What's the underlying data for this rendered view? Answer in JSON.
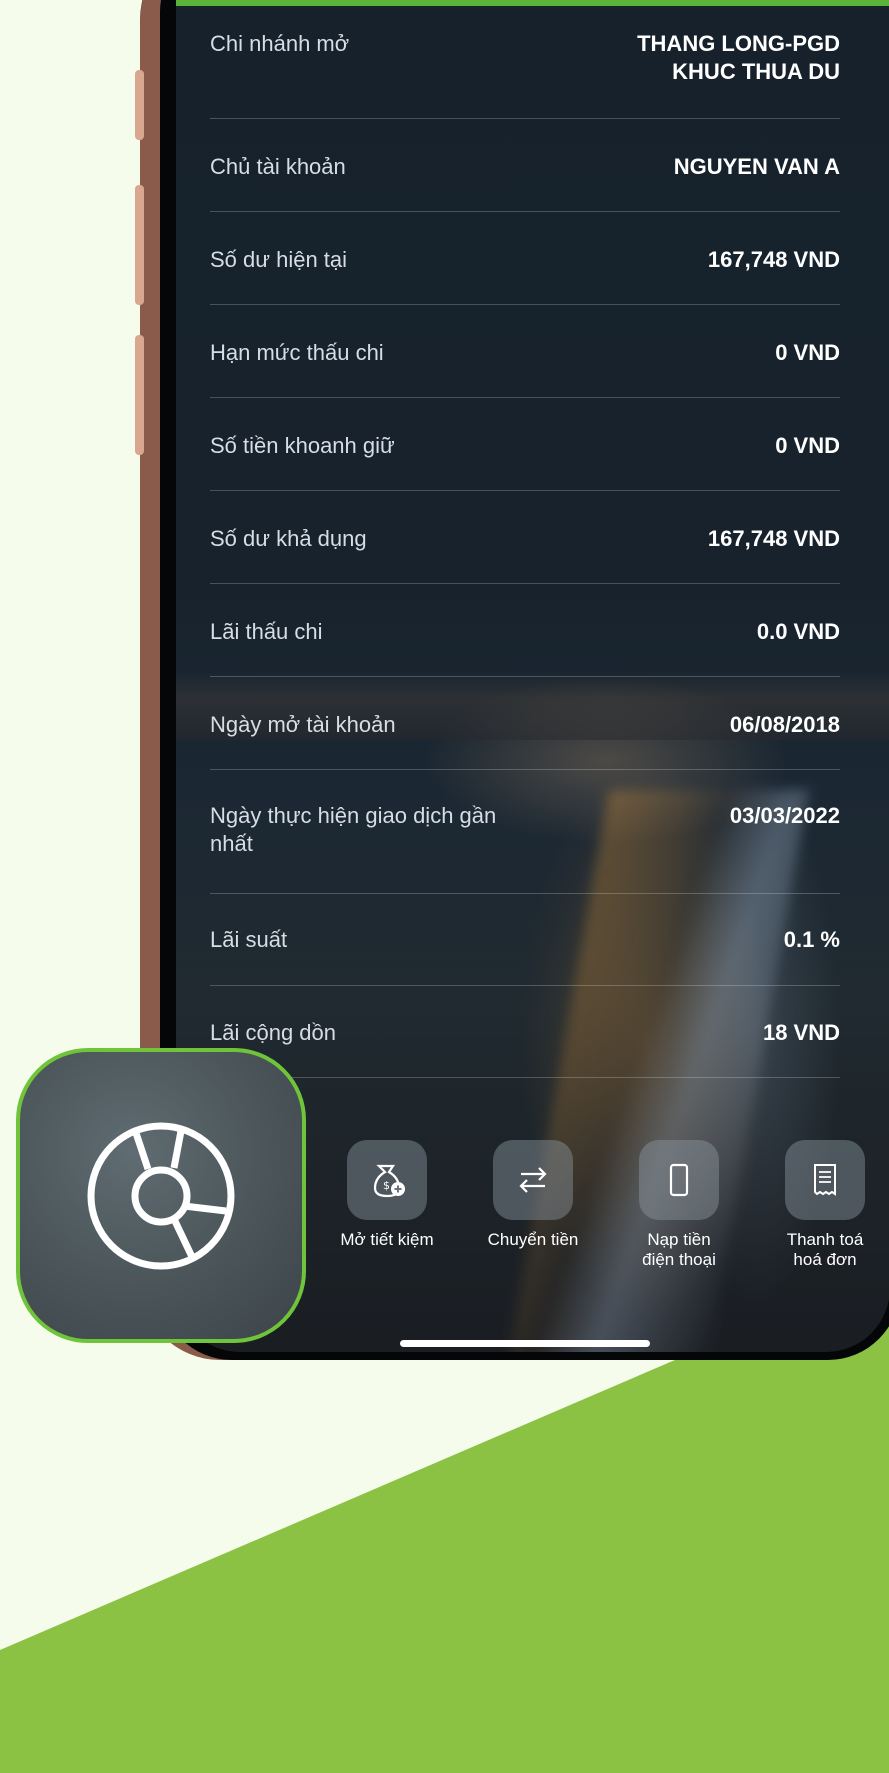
{
  "colors": {
    "accent_green": "#8bc243",
    "background": "#f6fcec",
    "badge_border": "#6fc43a"
  },
  "account_details": [
    {
      "label": "Chi nhánh mở",
      "value": "THANG LONG-PGD\nKHUC THUA DU"
    },
    {
      "label": "Chủ tài khoản",
      "value": "NGUYEN VAN A"
    },
    {
      "label": "Số dư hiện tại",
      "value": "167,748 VND"
    },
    {
      "label": "Hạn mức thấu chi",
      "value": "0 VND"
    },
    {
      "label": "Số tiền khoanh giữ",
      "value": "0 VND"
    },
    {
      "label": "Số dư khả dụng",
      "value": "167,748 VND"
    },
    {
      "label": "Lãi thấu chi",
      "value": "0.0 VND"
    },
    {
      "label": "Ngày mở tài khoản",
      "value": "06/08/2018"
    },
    {
      "label": "Ngày thực hiện giao dịch gần nhất",
      "value": "03/03/2022"
    },
    {
      "label": "Lãi suất",
      "value": "0.1 %"
    },
    {
      "label": "Lãi cộng dồn",
      "value": "18 VND"
    }
  ],
  "actions": [
    {
      "label": "Mở tiết kiệm",
      "icon": "money-bag-plus-icon"
    },
    {
      "label": "Chuyển tiền",
      "icon": "transfer-arrows-icon"
    },
    {
      "label": "Nạp tiền\nđiện thoại",
      "icon": "phone-icon"
    },
    {
      "label": "Thanh toá\nhoá đơn",
      "icon": "receipt-icon"
    }
  ],
  "badge": {
    "icon": "pie-chart-icon"
  }
}
